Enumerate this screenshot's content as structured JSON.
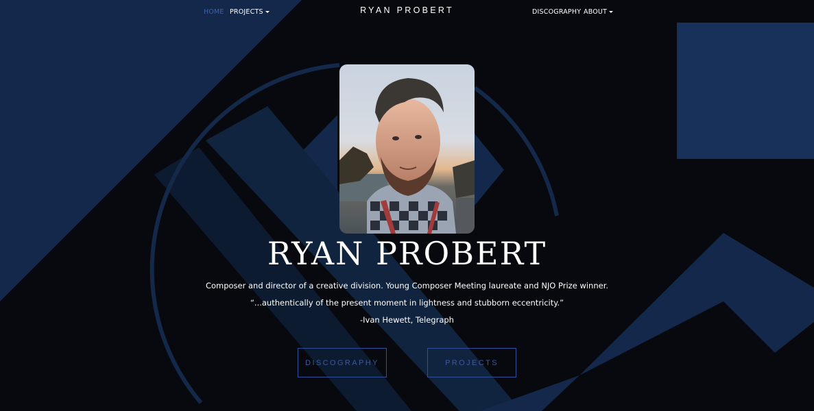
{
  "nav": {
    "home_label": "HOME",
    "projects_label": "PROJECTS",
    "brand": "RYAN PROBERT",
    "discography_label": "DISCOGRAPHY",
    "about_label": "ABOUT"
  },
  "hero": {
    "name": "RYAN PROBERT",
    "bio": "Composer and director of a creative division. Young Composer Meeting laureate and NJO Prize winner.",
    "quote": "“...authentically of the present moment in lightness and stubborn eccentricity.”",
    "attribution": "-Ivan Hewett, Telegraph",
    "buttons": {
      "discography": "DISCOGRAPHY",
      "projects": "PROJECTS"
    }
  },
  "colors": {
    "background": "#08090e",
    "shape_blue": "#14294a",
    "accent": "#3b64b0",
    "button_border": "#2f4f98"
  },
  "icons": {
    "dropdown": "caret-down-icon"
  }
}
